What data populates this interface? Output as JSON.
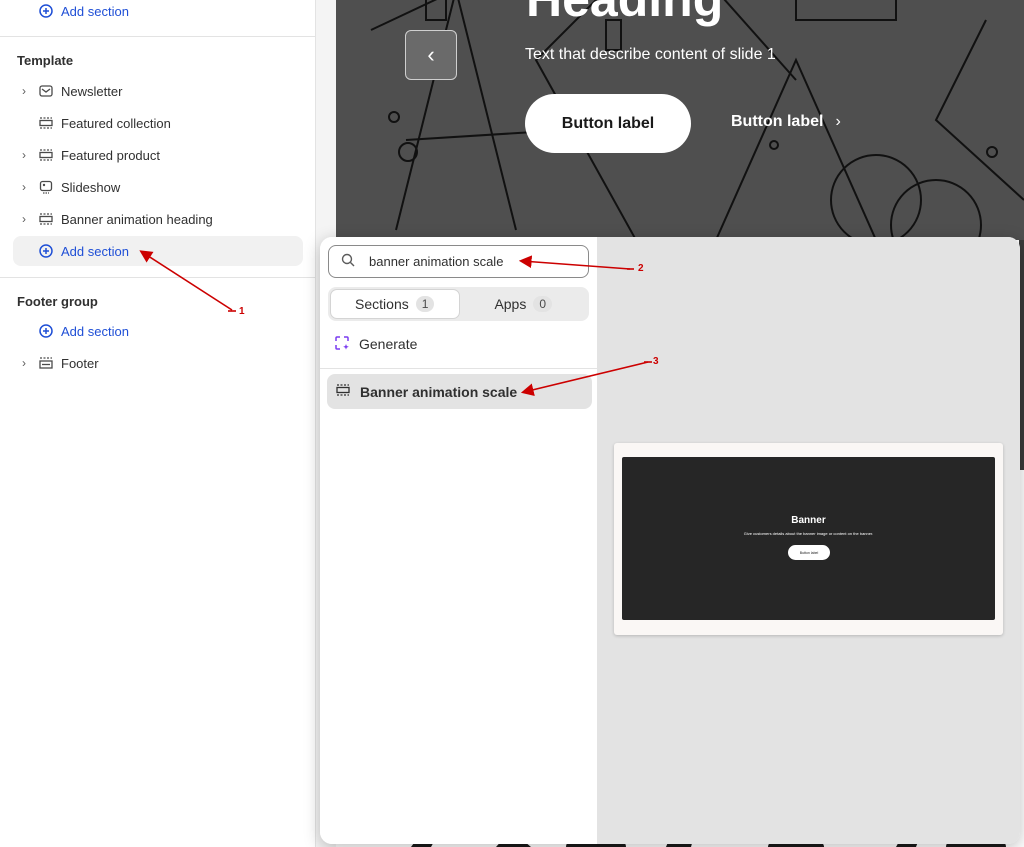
{
  "sidebar": {
    "top_add_section": "Add section",
    "template_title": "Template",
    "template_items": [
      {
        "label": "Newsletter",
        "icon": "envelope-icon",
        "has_chevron": true
      },
      {
        "label": "Featured collection",
        "icon": "section-icon",
        "has_chevron": false
      },
      {
        "label": "Featured product",
        "icon": "section-icon",
        "has_chevron": true
      },
      {
        "label": "Slideshow",
        "icon": "slideshow-icon",
        "has_chevron": true
      },
      {
        "label": "Banner animation heading",
        "icon": "section-icon",
        "has_chevron": true
      }
    ],
    "template_add_section": "Add section",
    "footer_title": "Footer group",
    "footer_add_section": "Add section",
    "footer_items": [
      {
        "label": "Footer",
        "icon": "footer-icon",
        "has_chevron": true
      }
    ]
  },
  "preview": {
    "heading_fragment": "Heading",
    "slide_text": "Text that describe content of slide 1",
    "primary_button": "Button label",
    "secondary_button": "Button label"
  },
  "popover": {
    "search_value": "banner animation scale",
    "tabs": [
      {
        "label": "Sections",
        "count": "1",
        "active": true
      },
      {
        "label": "Apps",
        "count": "0",
        "active": false
      }
    ],
    "generate_label": "Generate",
    "results": [
      {
        "label": "Banner animation scale",
        "icon": "section-icon"
      }
    ],
    "thumbnail": {
      "title": "Banner",
      "description": "Give customers details about the banner image or content on the banner.",
      "button": "Button label"
    }
  },
  "annotations": [
    "1",
    "2",
    "3"
  ],
  "colors": {
    "accent_blue": "#1f4fd6",
    "annotation_red": "#cc0000",
    "generate_purple": "#7a3cf0",
    "preview_bg": "#4f4f4f"
  }
}
